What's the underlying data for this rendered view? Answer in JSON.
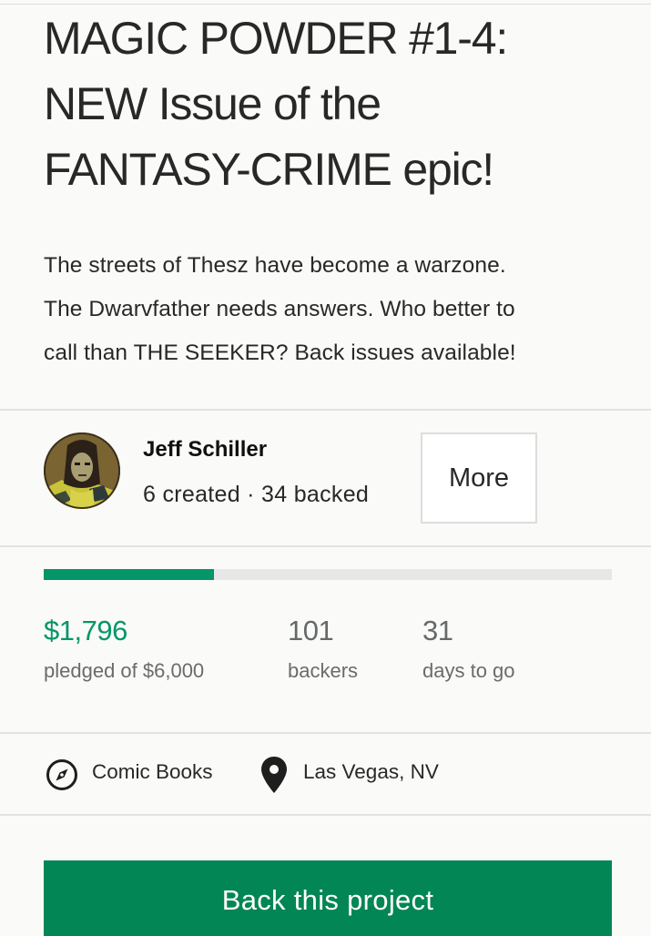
{
  "project": {
    "title_lines": [
      "MAGIC POWDER #1-4:",
      "NEW Issue of the",
      "FANTASY-CRIME epic!"
    ],
    "blurb_lines": [
      "The streets of Thesz have become a warzone.",
      "The Dwarvfather needs answers. Who better to",
      "call than THE SEEKER? Back issues available!"
    ]
  },
  "creator": {
    "name": "Jeff Schiller",
    "stats": "6 created · 34 backed",
    "more_label": "More",
    "avatar_icon": "creator-avatar"
  },
  "funding": {
    "progress_fraction": 0.2993,
    "pledged_value": "$1,796",
    "pledged_label": "pledged of $6,000",
    "backers_value": "101",
    "backers_label": "backers",
    "days_value": "31",
    "days_label": "days to go"
  },
  "meta": {
    "category": "Comic Books",
    "category_icon": "compass-icon",
    "location": "Las Vegas, NV",
    "location_icon": "map-pin-icon"
  },
  "cta": {
    "back_label": "Back this project"
  },
  "colors": {
    "accent_green": "#049669",
    "button_green": "#038655",
    "progress_track": "#e6e7e6"
  }
}
